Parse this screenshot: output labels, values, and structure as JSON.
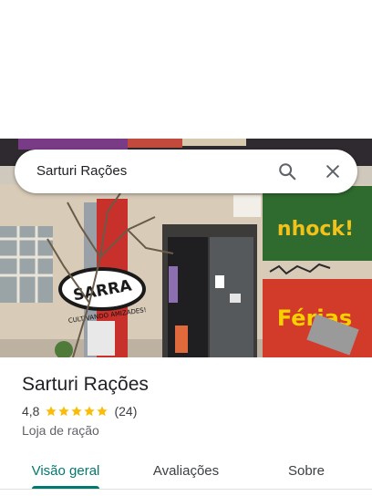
{
  "search": {
    "query": "Sarturi Rações"
  },
  "photo": {
    "sign_text": "SARRA",
    "sign_slogan": "CULTIVANDO AMIZADES!",
    "mural_top": "nhock!",
    "mural_bottom": "Férias"
  },
  "place": {
    "name": "Sarturi Rações",
    "rating": "4,8",
    "stars": 5,
    "review_count": "(24)",
    "category": "Loja de ração"
  },
  "tabs": [
    {
      "label": "Visão geral",
      "active": true
    },
    {
      "label": "Avaliações",
      "active": false
    },
    {
      "label": "Sobre",
      "active": false
    }
  ],
  "colors": {
    "accent": "#01796f",
    "star": "#fbbc04"
  },
  "icons": {
    "search": "search-icon",
    "close": "close-icon"
  }
}
